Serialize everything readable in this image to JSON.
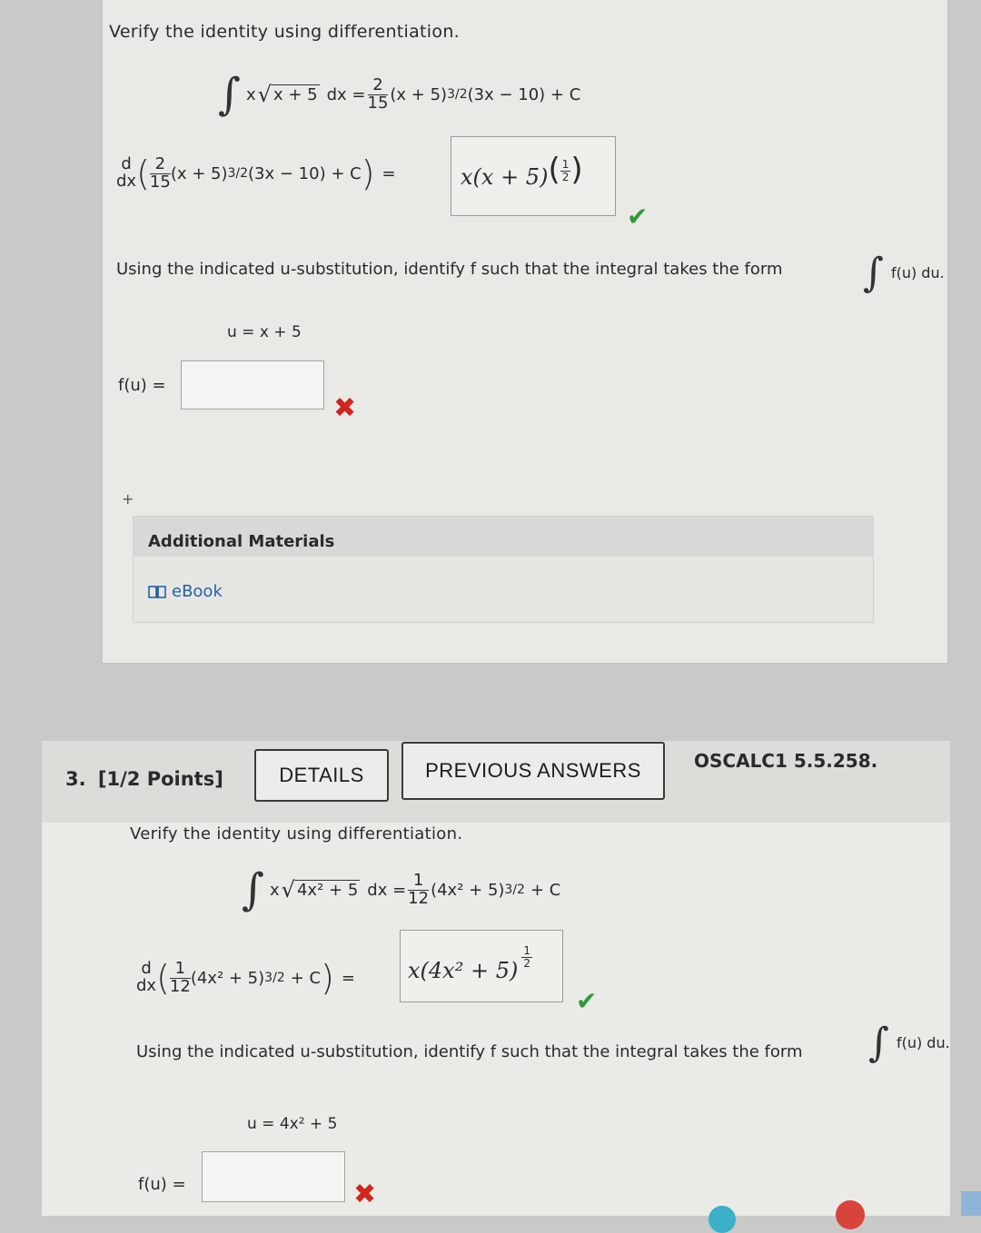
{
  "problem2": {
    "heading": "Verify the identity using differentiation.",
    "integrand_x": "x",
    "integrand_radicand": "x + 5",
    "dx": "dx =",
    "rhs_num": "2",
    "rhs_den": "15",
    "rhs_rest": "(x + 5)",
    "rhs_exp": "3/2",
    "rhs_tail": "(3x − 10) + C",
    "deriv_d": "d",
    "deriv_dx": "dx",
    "deriv_num": "2",
    "deriv_den": "15",
    "deriv_body": "(x + 5)",
    "deriv_exp": "3/2",
    "deriv_tail": "(3x − 10) + C",
    "equals": "=",
    "answer_main": "x(x + 5)",
    "answer_exp_num": "1",
    "answer_exp_den": "2",
    "usub_text": "Using the indicated u-substitution, identify f such that the integral takes the form",
    "form_text": "f(u) du.",
    "u_def": "u = x + 5",
    "fu_label": "f(u) =",
    "fu_value": "",
    "plus": "+",
    "additional_materials": "Additional Materials",
    "ebook": "eBook"
  },
  "problem3": {
    "number": "3.",
    "points": "[1/2 Points]",
    "details_btn": "DETAILS",
    "previous_btn": "PREVIOUS ANSWERS",
    "code": "OSCALC1 5.5.258.",
    "heading": "Verify the identity using differentiation.",
    "integrand_x": "x",
    "integrand_radicand": "4x² + 5",
    "dx": "dx =",
    "rhs_num": "1",
    "rhs_den": "12",
    "rhs_rest": "(4x² + 5)",
    "rhs_exp": "3/2",
    "rhs_tail": "+ C",
    "deriv_d": "d",
    "deriv_dx": "dx",
    "deriv_num": "1",
    "deriv_den": "12",
    "deriv_body": "(4x² + 5)",
    "deriv_exp": "3/2",
    "deriv_tail": "+ C",
    "equals": "=",
    "answer_main": "x(4x² + 5)",
    "answer_exp_num": "1",
    "answer_exp_den": "2",
    "usub_text": "Using the indicated u-substitution, identify f such that the integral takes the form",
    "form_text": "f(u) du.",
    "u_def": "u = 4x² + 5",
    "fu_label": "f(u) =",
    "fu_value": ""
  },
  "colors": {
    "check": "#2f9a3c",
    "xmark": "#d0261d",
    "link": "#2a5fa8"
  },
  "icons": [
    "check-icon",
    "x-mark-icon",
    "book-icon",
    "integral-icon"
  ]
}
